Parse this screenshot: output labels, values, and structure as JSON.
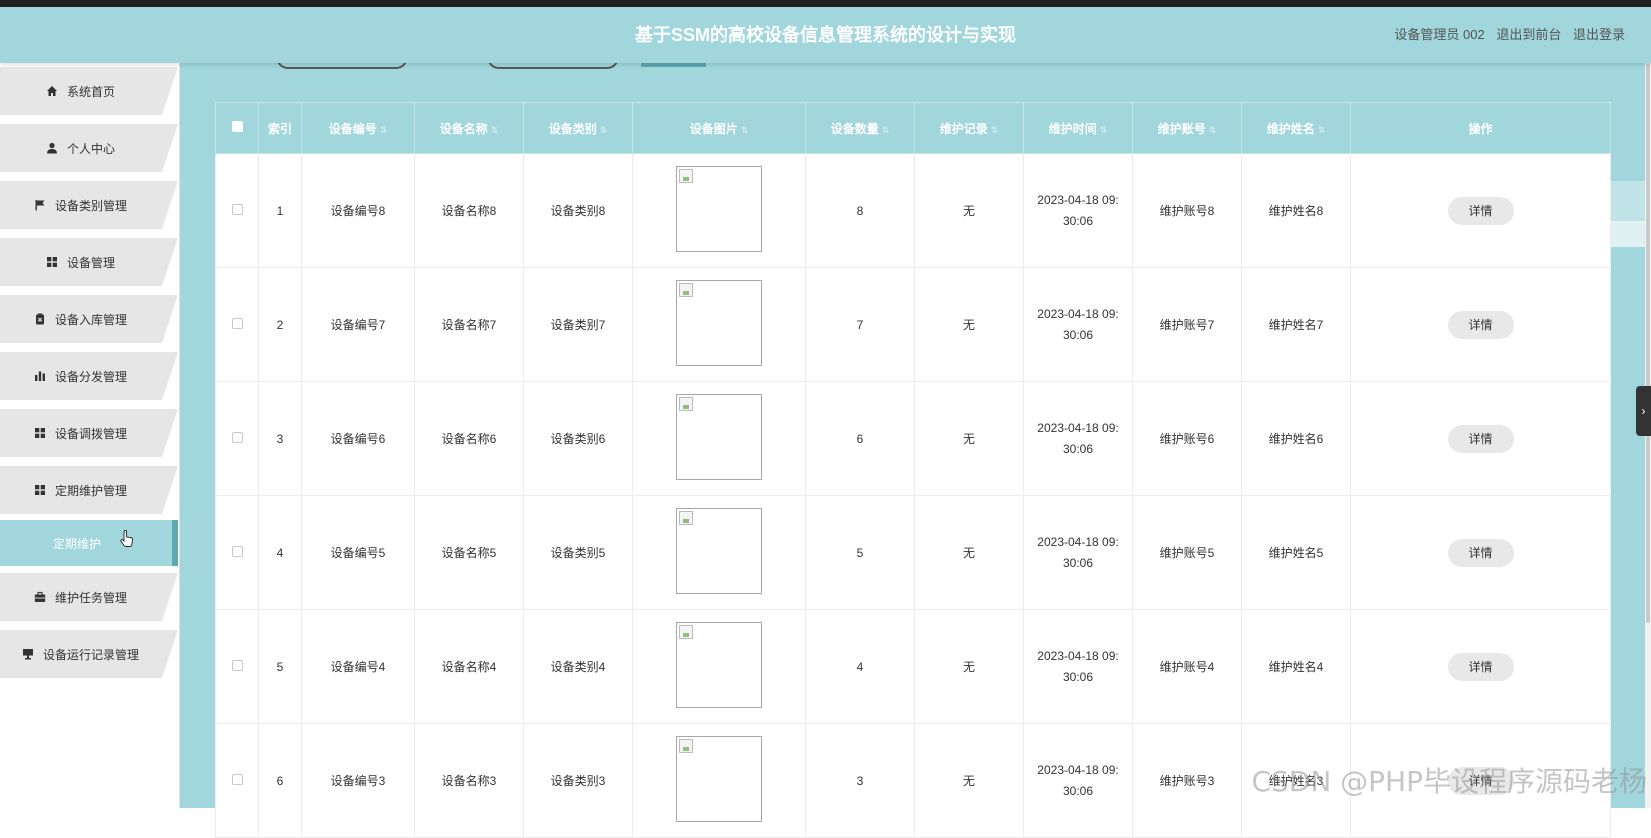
{
  "header": {
    "title": "基于SSM的高校设备信息管理系统的设计与实现",
    "user_label": "设备管理员 002",
    "to_front": "退出到前台",
    "logout": "退出登录"
  },
  "sidebar": {
    "items": [
      {
        "label": "系统首页",
        "icon": "home-icon"
      },
      {
        "label": "个人中心",
        "icon": "user-icon"
      },
      {
        "label": "设备类别管理",
        "icon": "flag-icon"
      },
      {
        "label": "设备管理",
        "icon": "grid-icon"
      },
      {
        "label": "设备入库管理",
        "icon": "clipboard-icon"
      },
      {
        "label": "设备分发管理",
        "icon": "bar-chart-icon"
      },
      {
        "label": "设备调拨管理",
        "icon": "grid-icon"
      },
      {
        "label": "定期维护管理",
        "icon": "grid-icon"
      },
      {
        "label": "定期维护",
        "icon": "",
        "active": true
      },
      {
        "label": "维护任务管理",
        "icon": "briefcase-icon"
      },
      {
        "label": "设备运行记录管理",
        "icon": "monitor-icon"
      }
    ]
  },
  "table": {
    "headers": [
      "索引",
      "设备编号",
      "设备名称",
      "设备类别",
      "设备图片",
      "设备数量",
      "维护记录",
      "维护时间",
      "维护账号",
      "维护姓名",
      "操作"
    ],
    "rows": [
      {
        "index": "1",
        "code": "设备编号8",
        "name": "设备名称8",
        "category": "设备类别8",
        "count": "8",
        "record": "无",
        "time1": "2023-04-18 09:",
        "time2": "30:06",
        "account": "维护账号8",
        "maint_name": "维护姓名8",
        "action": "详情"
      },
      {
        "index": "2",
        "code": "设备编号7",
        "name": "设备名称7",
        "category": "设备类别7",
        "count": "7",
        "record": "无",
        "time1": "2023-04-18 09:",
        "time2": "30:06",
        "account": "维护账号7",
        "maint_name": "维护姓名7",
        "action": "详情"
      },
      {
        "index": "3",
        "code": "设备编号6",
        "name": "设备名称6",
        "category": "设备类别6",
        "count": "6",
        "record": "无",
        "time1": "2023-04-18 09:",
        "time2": "30:06",
        "account": "维护账号6",
        "maint_name": "维护姓名6",
        "action": "详情"
      },
      {
        "index": "4",
        "code": "设备编号5",
        "name": "设备名称5",
        "category": "设备类别5",
        "count": "5",
        "record": "无",
        "time1": "2023-04-18 09:",
        "time2": "30:06",
        "account": "维护账号5",
        "maint_name": "维护姓名5",
        "action": "详情"
      },
      {
        "index": "5",
        "code": "设备编号4",
        "name": "设备名称4",
        "category": "设备类别4",
        "count": "4",
        "record": "无",
        "time1": "2023-04-18 09:",
        "time2": "30:06",
        "account": "维护账号4",
        "maint_name": "维护姓名4",
        "action": "详情"
      },
      {
        "index": "6",
        "code": "设备编号3",
        "name": "设备名称3",
        "category": "设备类别3",
        "count": "3",
        "record": "无",
        "time1": "2023-04-18 09:",
        "time2": "30:06",
        "account": "维护账号3",
        "maint_name": "维护姓名3",
        "action": "详情"
      }
    ]
  },
  "watermark": "CSDN @PHP毕设程序源码老杨",
  "side_toggle": "›",
  "colors": {
    "accent": "#a0d6dc",
    "accent_dark": "#5ea8b0",
    "menu_bg": "#e6e6e6"
  }
}
